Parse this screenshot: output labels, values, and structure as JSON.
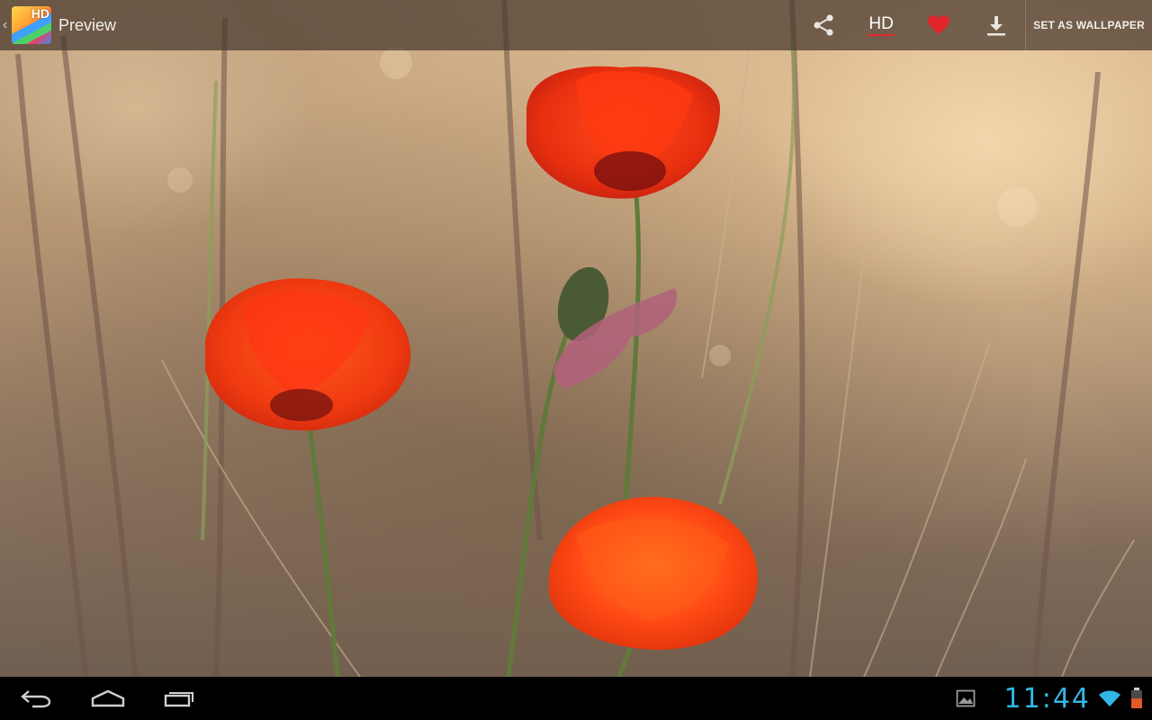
{
  "action_bar": {
    "title": "Preview",
    "app_icon_badge": "HD",
    "actions": {
      "share_icon": "share-icon",
      "hd_label": "HD",
      "favorite_icon": "heart-icon",
      "download_icon": "download-icon",
      "set_wallpaper_label": "SET AS WALLPAPER"
    },
    "colors": {
      "hd_underline": "#e0262b",
      "heart": "#e0262b"
    }
  },
  "navigation_bar": {
    "buttons": [
      "back-icon",
      "home-icon",
      "recent-apps-icon"
    ],
    "clock": "11:44",
    "status_icons": [
      "gallery-notification-icon",
      "wifi-icon",
      "battery-icon"
    ],
    "colors": {
      "clock": "#33b5e5",
      "wifi": "#33b5e5",
      "battery_low": "#e05a2a"
    }
  },
  "content": {
    "image": "poppy-field-wallpaper"
  }
}
